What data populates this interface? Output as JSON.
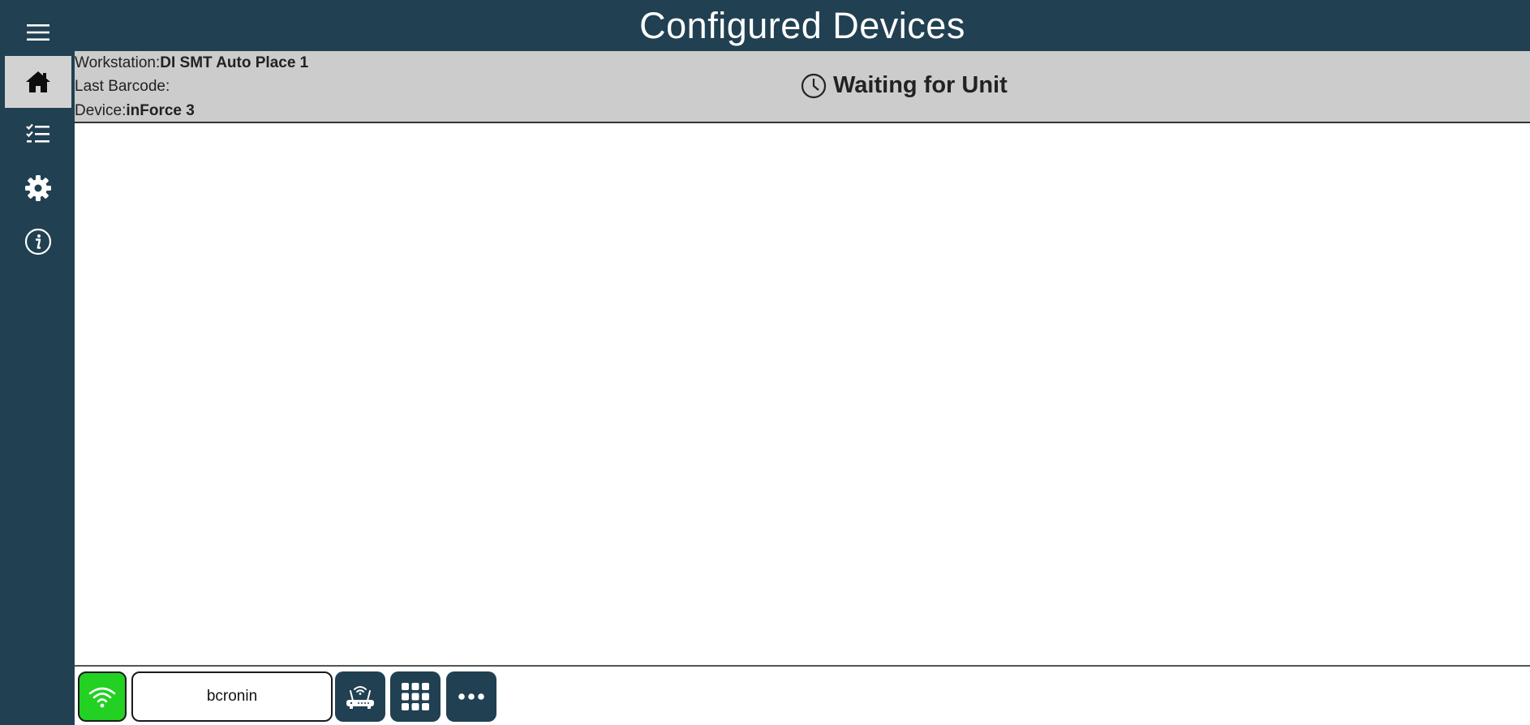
{
  "app": {
    "title": "Configured Devices"
  },
  "sidebar": {
    "items": [
      {
        "name": "menu",
        "icon": "hamburger-menu-icon"
      },
      {
        "name": "home",
        "icon": "home-icon",
        "active": true
      },
      {
        "name": "checklist",
        "icon": "checklist-icon"
      },
      {
        "name": "settings",
        "icon": "gear-icon"
      },
      {
        "name": "info",
        "icon": "info-icon"
      }
    ]
  },
  "info": {
    "workstation_label": "Workstation:",
    "workstation_value": "DI SMT Auto Place 1",
    "barcode_label": "Last Barcode:",
    "barcode_value": "",
    "device_label": "Device:",
    "device_value": "inForce 3"
  },
  "status": {
    "text": "Waiting for Unit",
    "icon": "clock-icon"
  },
  "footer": {
    "wifi_icon": "wifi-icon",
    "wifi_color": "#22d122",
    "username": "bcronin",
    "router_icon": "router-icon",
    "keypad_icon": "keypad-grid-icon",
    "more_icon": "more-dots-icon"
  },
  "colors": {
    "primary": "#214052",
    "infobar": "#cccccc",
    "active_nav": "#d2d2d2"
  }
}
